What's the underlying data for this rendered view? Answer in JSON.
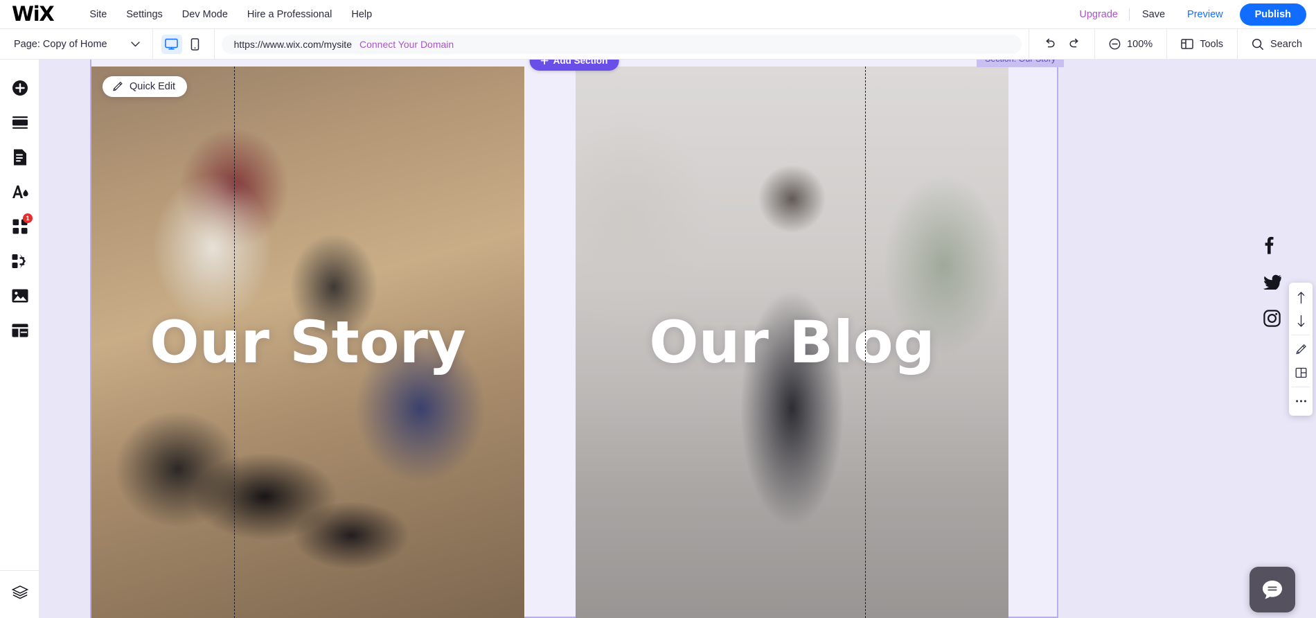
{
  "app": {
    "name": "Wix Editor",
    "logo_text": "WiX"
  },
  "topbar": {
    "menu": [
      {
        "label": "Site",
        "name": "menu-site"
      },
      {
        "label": "Settings",
        "name": "menu-settings"
      },
      {
        "label": "Dev Mode",
        "name": "menu-dev-mode"
      },
      {
        "label": "Hire a Professional",
        "name": "menu-hire-a-professional"
      },
      {
        "label": "Help",
        "name": "menu-help"
      }
    ],
    "upgrade_label": "Upgrade",
    "save_label": "Save",
    "preview_label": "Preview",
    "publish_label": "Publish",
    "colors": {
      "upgrade": "#a855c8",
      "preview": "#116dff",
      "publish_bg": "#116dff"
    }
  },
  "toolbar": {
    "page_label": "Page: Copy of Home",
    "page_chevron_icon": "chevron-down-icon",
    "devices": [
      {
        "name": "desktop-view-button",
        "icon": "monitor-icon",
        "active": true
      },
      {
        "name": "mobile-view-button",
        "icon": "mobile-icon",
        "active": false
      }
    ],
    "url": "https://www.wix.com/mysite",
    "connect_domain_label": "Connect Your Domain",
    "undo_icon": "undo-arrow-icon",
    "redo_icon": "redo-arrow-icon",
    "zoom_label": "100%",
    "zoom_icon": "zoom-out-circle-icon",
    "tools_label": "Tools",
    "tools_icon": "panel-layout-icon",
    "search_label": "Search",
    "search_icon": "magnifier-icon"
  },
  "sidebar": {
    "items": [
      {
        "label": "Add Elements",
        "name": "sidebar-item-add",
        "icon": "plus-circle-icon",
        "badge": ""
      },
      {
        "label": "Add Section",
        "name": "sidebar-item-sections",
        "icon": "sections-icon",
        "badge": ""
      },
      {
        "label": "Pages & Menu",
        "name": "sidebar-item-pages",
        "icon": "page-document-icon",
        "badge": ""
      },
      {
        "label": "Site Design",
        "name": "sidebar-item-design",
        "icon": "theme-droplet-icon",
        "badge": ""
      },
      {
        "label": "Apps",
        "name": "sidebar-item-apps",
        "icon": "four-squares-icon",
        "badge": "1"
      },
      {
        "label": "My Business",
        "name": "sidebar-item-business",
        "icon": "squares-arrow-icon",
        "badge": ""
      },
      {
        "label": "Media",
        "name": "sidebar-item-media",
        "icon": "image-icon",
        "badge": ""
      },
      {
        "label": "Content Manager",
        "name": "sidebar-item-cms",
        "icon": "table-grid-icon",
        "badge": ""
      }
    ],
    "bottom_item": {
      "label": "Layers",
      "name": "sidebar-item-layers",
      "icon": "layers-icon"
    }
  },
  "canvas": {
    "section_tab_label": "Section: Our Story",
    "add_section_label": "Add Section",
    "add_section_icon": "plus-icon",
    "quick_edit_label": "Quick Edit",
    "quick_edit_icon": "pencil-icon",
    "panels": [
      {
        "name": "hero-panel-our-story",
        "title": "Our Story",
        "image": "folded-clothes-shoes-on-wood-floor"
      },
      {
        "name": "hero-panel-our-blog",
        "title": "Our Blog",
        "image": "man-in-scarf-and-coat-on-city-street"
      }
    ],
    "colors": {
      "canvas_bg": "#e9e7f7",
      "selection_border": "#b9aee8",
      "add_section_bg": "#6a4ee8",
      "section_tab_bg": "#c9bff0"
    }
  },
  "social": [
    {
      "label": "Facebook",
      "name": "facebook-icon"
    },
    {
      "label": "Twitter",
      "name": "twitter-icon"
    },
    {
      "label": "Instagram",
      "name": "instagram-icon"
    }
  ],
  "side_panel": {
    "buttons": [
      {
        "label": "Move Section Up",
        "name": "move-up-icon"
      },
      {
        "label": "Move Section Down",
        "name": "move-down-icon"
      },
      {
        "label": "Edit Section",
        "name": "pencil-edit-icon"
      },
      {
        "label": "Change Layout",
        "name": "layout-split-icon"
      },
      {
        "label": "More Actions",
        "name": "more-dots-icon"
      }
    ]
  },
  "chat": {
    "label": "Chat",
    "name": "chat-bubble-icon"
  }
}
